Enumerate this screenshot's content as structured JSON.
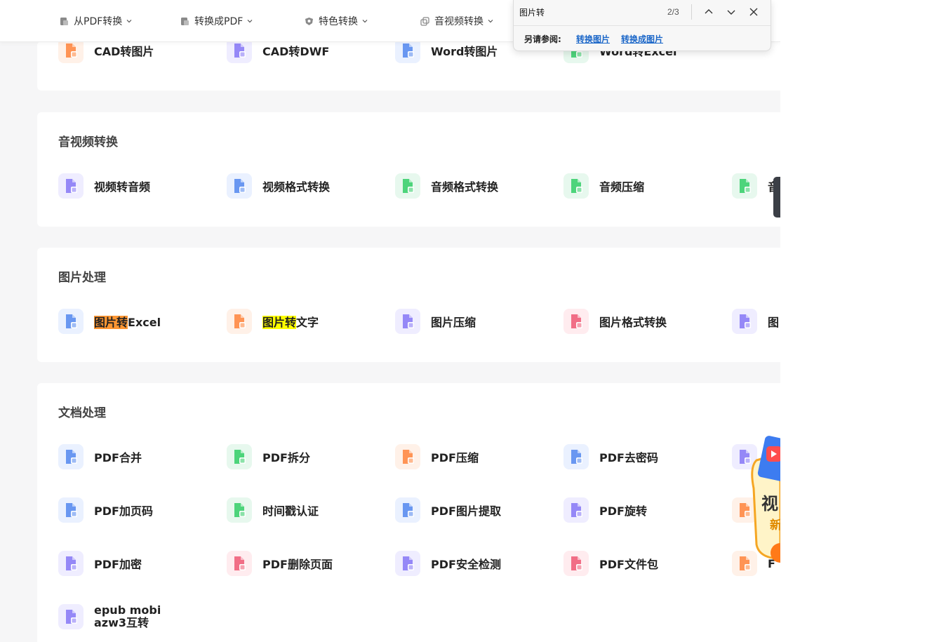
{
  "nav": [
    {
      "label": "从PDF转换"
    },
    {
      "label": "转换成PDF"
    },
    {
      "label": "特色转换"
    },
    {
      "label": "音视频转换"
    }
  ],
  "find": {
    "query": "图片转",
    "count": "2/3",
    "see_also_label": "另请参阅:",
    "links": [
      "转换图片",
      "转换成图片"
    ]
  },
  "cad_row": [
    {
      "label": "CAD转图片",
      "icon": "cad-image-icon",
      "color": "#ff8a45",
      "bg": "#fff1e8"
    },
    {
      "label": "CAD转DWF",
      "icon": "cad-dwf-icon",
      "color": "#8b7cf6",
      "bg": "#efedff"
    },
    {
      "label": "Word转图片",
      "icon": "word-image-icon",
      "color": "#5b8def",
      "bg": "#eaf1ff"
    },
    {
      "label": "Word转Excel",
      "icon": "word-excel-icon",
      "color": "#3ccf6e",
      "bg": "#e7f8ee"
    }
  ],
  "sections": {
    "av": {
      "title": "音视频转换",
      "items": [
        {
          "label": "视频转音频",
          "icon": "video-audio-icon",
          "color": "#8b7cf6",
          "bg": "#efedff"
        },
        {
          "label": "视频格式转换",
          "icon": "video-format-icon",
          "color": "#5b8def",
          "bg": "#eaf1ff"
        },
        {
          "label": "音频格式转换",
          "icon": "audio-format-icon",
          "color": "#3ccf6e",
          "bg": "#e7f8ee"
        },
        {
          "label": "音频压缩",
          "icon": "audio-compress-icon",
          "color": "#3ccf6e",
          "bg": "#e7f8ee"
        },
        {
          "label": "音",
          "icon": "audio-cut-icon",
          "color": "#3ccf6e",
          "bg": "#e7f8ee"
        }
      ]
    },
    "image": {
      "title": "图片处理",
      "items": [
        {
          "hl": "图片转",
          "rest": "Excel",
          "hl_class": "hl-orange",
          "icon": "image-excel-icon",
          "color": "#5b8def",
          "bg": "#eaf1ff"
        },
        {
          "hl": "图片转",
          "rest": "文字",
          "hl_class": "hl-yellow",
          "icon": "image-text-icon",
          "color": "#ff8a45",
          "bg": "#fff1e8"
        },
        {
          "hl": "",
          "rest": "图片压缩",
          "hl_class": "",
          "icon": "image-compress-icon",
          "color": "#8b7cf6",
          "bg": "#efedff"
        },
        {
          "hl": "",
          "rest": "图片格式转换",
          "hl_class": "",
          "icon": "image-format-icon",
          "color": "#f0607a",
          "bg": "#ffecef"
        },
        {
          "hl": "",
          "rest": "图",
          "hl_class": "",
          "icon": "image-edit-icon",
          "color": "#8b7cf6",
          "bg": "#efedff"
        }
      ]
    },
    "doc": {
      "title": "文档处理",
      "rows": [
        [
          {
            "label": "PDF合并",
            "icon": "pdf-merge-icon",
            "color": "#5b8def",
            "bg": "#eaf1ff"
          },
          {
            "label": "PDF拆分",
            "icon": "pdf-split-icon",
            "color": "#3ccf6e",
            "bg": "#e7f8ee"
          },
          {
            "label": "PDF压缩",
            "icon": "pdf-compress-icon",
            "color": "#ff8a45",
            "bg": "#fff1e8"
          },
          {
            "label": "PDF去密码",
            "icon": "pdf-unlock-icon",
            "color": "#5b8def",
            "bg": "#eaf1ff"
          },
          {
            "label": "",
            "icon": "pdf-sign-icon",
            "color": "#8b7cf6",
            "bg": "#efedff"
          }
        ],
        [
          {
            "label": "PDF加页码",
            "icon": "pdf-pagenum-icon",
            "color": "#5b8def",
            "bg": "#eaf1ff"
          },
          {
            "label": "时间戳认证",
            "icon": "timestamp-icon",
            "color": "#3ccf6e",
            "bg": "#e7f8ee"
          },
          {
            "label": "PDF图片提取",
            "icon": "pdf-extract-image-icon",
            "color": "#5b8def",
            "bg": "#eaf1ff"
          },
          {
            "label": "PDF旋转",
            "icon": "pdf-rotate-icon",
            "color": "#8b7cf6",
            "bg": "#efedff"
          },
          {
            "label": "",
            "icon": "pdf-form-icon",
            "color": "#ff8a45",
            "bg": "#fff1e8"
          }
        ],
        [
          {
            "label": "PDF加密",
            "icon": "pdf-lock-icon",
            "color": "#8b7cf6",
            "bg": "#efedff"
          },
          {
            "label": "PDF删除页面",
            "icon": "pdf-delete-page-icon",
            "color": "#f0607a",
            "bg": "#ffecef"
          },
          {
            "label": "PDF安全检测",
            "icon": "pdf-security-icon",
            "color": "#8b7cf6",
            "bg": "#efedff"
          },
          {
            "label": "PDF文件包",
            "icon": "pdf-package-icon",
            "color": "#f0607a",
            "bg": "#ffecef"
          },
          {
            "label": "F",
            "icon": "pdf-list-icon",
            "color": "#ff8a45",
            "bg": "#fff1e8"
          }
        ]
      ],
      "epub": {
        "line1": "epub mobi",
        "line2": "azw3互转",
        "icon": "ebook-icon",
        "color": "#8b7cf6",
        "bg": "#efedff"
      }
    }
  },
  "promo": {
    "t1": "视",
    "t2": "新"
  }
}
